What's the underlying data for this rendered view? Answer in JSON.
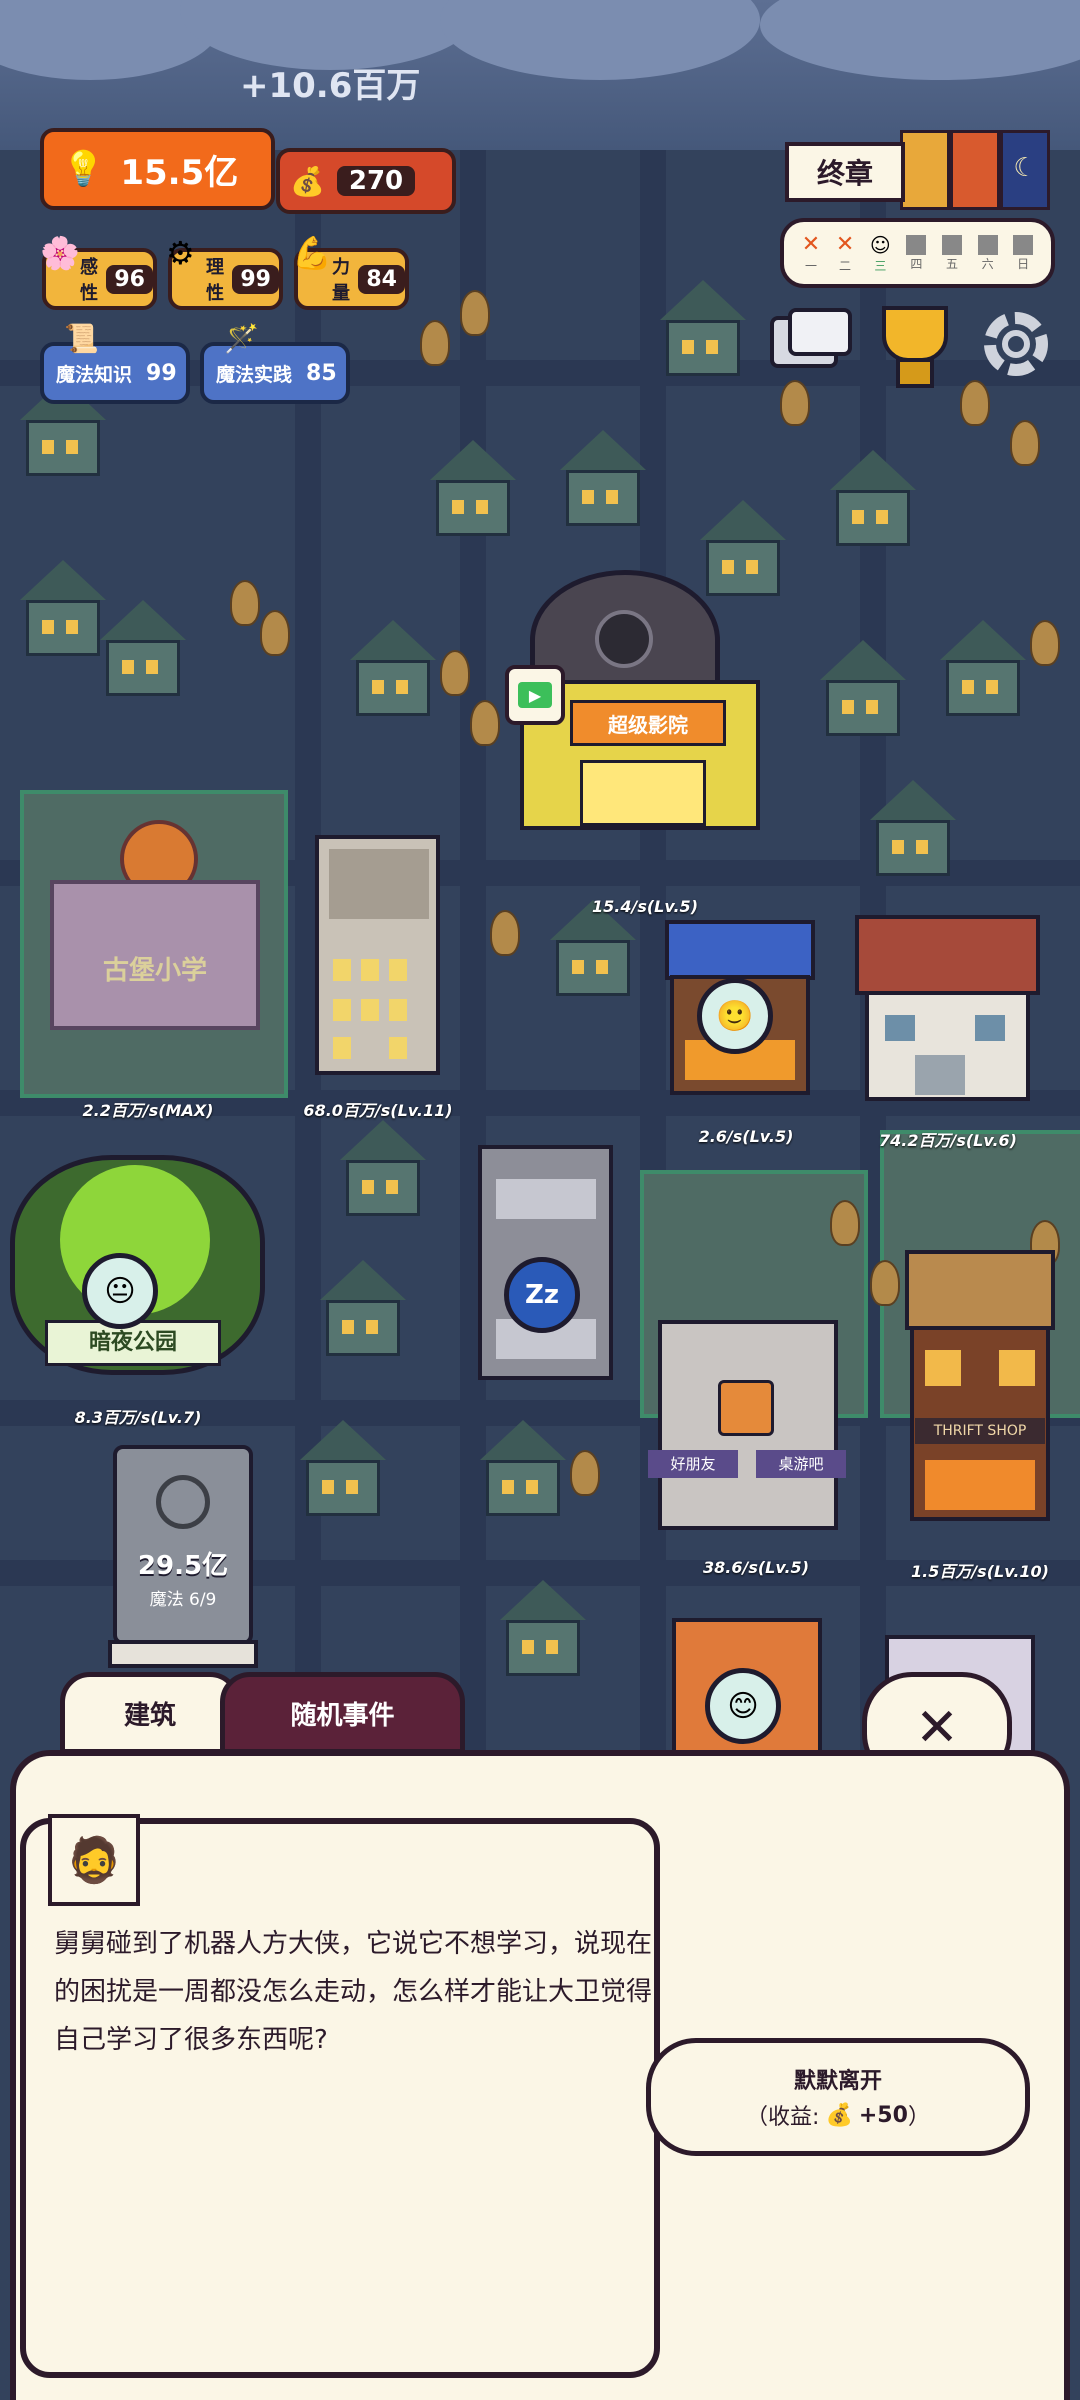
{
  "hud": {
    "income_popup": "+10.6百万",
    "idea_total": "15.5亿",
    "money": "270",
    "stats": [
      {
        "label": "感性",
        "value": "96",
        "icon": "flower-icon"
      },
      {
        "label": "理性",
        "value": "99",
        "icon": "gear-head-icon"
      },
      {
        "label": "力量",
        "value": "84",
        "icon": "muscle-icon"
      }
    ],
    "magic": [
      {
        "label": "魔法知识",
        "value": "99",
        "icon": "scroll-icon"
      },
      {
        "label": "魔法实践",
        "value": "85",
        "icon": "wand-icon"
      }
    ]
  },
  "chapter": {
    "title": "终章",
    "days": [
      "一",
      "二",
      "三",
      "四",
      "五",
      "六",
      "日"
    ],
    "day_marks": [
      "x",
      "x",
      "face",
      "blank",
      "blank",
      "blank",
      "blank"
    ]
  },
  "buildings": [
    {
      "label": "15.4/s(Lv.5)"
    },
    {
      "label": "2.2百万/s(MAX)"
    },
    {
      "label": "68.0百万/s(Lv.11)"
    },
    {
      "label": "2.6/s(Lv.5)"
    },
    {
      "label": "74.2百万/s(Lv.6)"
    },
    {
      "label": "8.3百万/s(Lv.7)"
    },
    {
      "label": "38.6/s(Lv.5)"
    },
    {
      "label": "1.5百万/s(Lv.10)"
    }
  ],
  "magic_book": {
    "value": "29.5亿",
    "sub": "魔法 6/9"
  },
  "signs": {
    "cinema": "超级影院",
    "school": "古堡小学",
    "park": "暗夜公园",
    "thrift": "THRIFT SHOP",
    "shop_left": "好朋友",
    "shop_right": "桌游吧"
  },
  "tabs": {
    "buildings": "建筑",
    "random_event": "随机事件"
  },
  "event": {
    "text": "舅舅碰到了机器人方大侠，它说它不想学习，说现在的困扰是一周都没怎么走动，怎么样才能让大卫觉得自己学习了很多东西呢?",
    "option_title": "默默离开",
    "option_reward_prefix": "（收益:",
    "option_reward_value": "+50",
    "option_reward_suffix": "）"
  },
  "colors": {
    "panel_bg": "#fbf6e6",
    "outline": "#2c1a2a",
    "tab_active": "#5b2239",
    "idea_orange": "#f26a1b",
    "money_red": "#d5492a",
    "stat_yellow": "#f2b53c",
    "magic_blue": "#4e73c6"
  }
}
